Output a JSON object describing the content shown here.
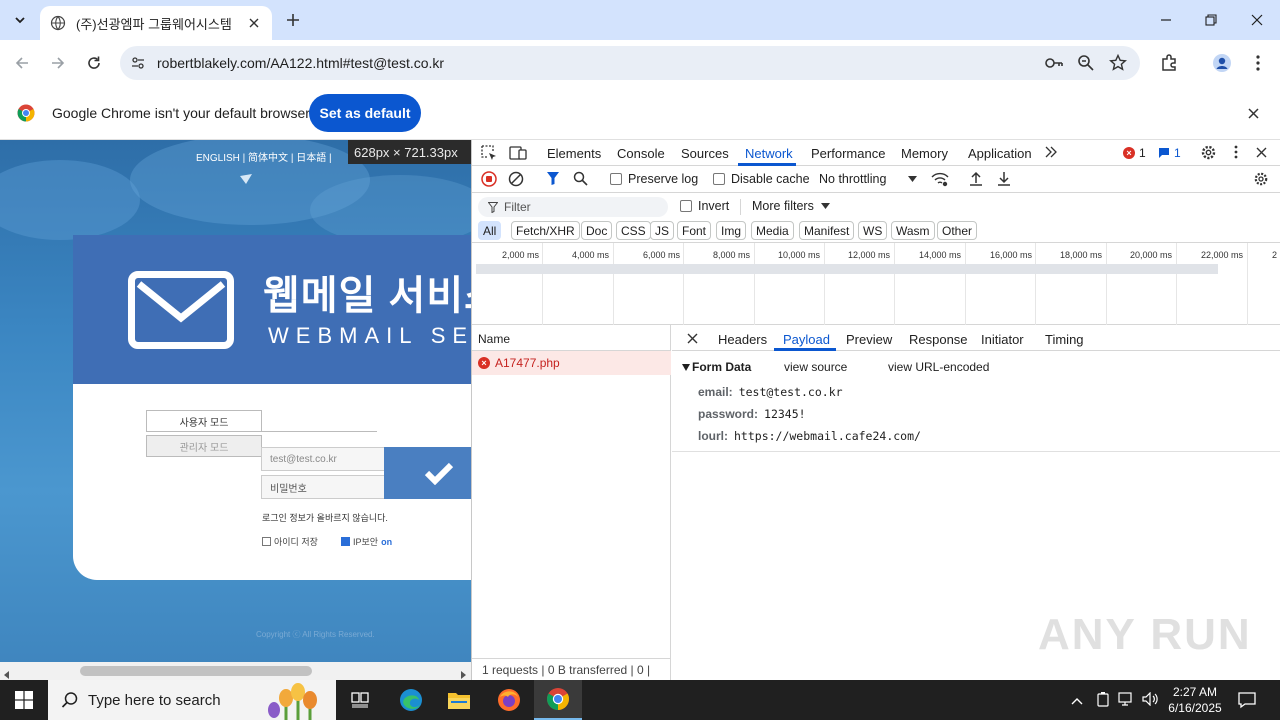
{
  "browser": {
    "tab_title": "(주)선광엠파 그룹웨어시스템",
    "url": "robertblakely.com/AA122.html#test@test.co.kr"
  },
  "infobar": {
    "message": "Google Chrome isn't your default browser",
    "button": "Set as default"
  },
  "webpage": {
    "lang_links": "ENGLISH  |  简体中文  |  日本語  |",
    "size_tooltip": "628px × 721.33px",
    "title": "웹메일 서비스",
    "subtitle": "WEBMAIL SERVICE",
    "user_mode_tab": "사용자 모드",
    "admin_mode_tab": "관리자 모드",
    "email_value": "test@test.co.kr",
    "password_placeholder": "비밀번호",
    "error_message": "로그인 정보가 올바르지 않습니다.",
    "save_id_label": "아이디 저장",
    "ip_security_label": "IP보안",
    "ip_security_state": "on",
    "copyright": "Copyright ⓒ All Rights Reserved."
  },
  "devtools": {
    "tabs": [
      "Elements",
      "Console",
      "Sources",
      "Network",
      "Performance",
      "Memory",
      "Application"
    ],
    "active_tab": "Network",
    "error_count": "1",
    "message_count": "1",
    "toolbar": {
      "preserve_log": "Preserve log",
      "disable_cache": "Disable cache",
      "throttling": "No throttling"
    },
    "filter": {
      "placeholder": "Filter",
      "invert": "Invert",
      "more_filters": "More filters"
    },
    "type_filters": [
      "All",
      "Fetch/XHR",
      "Doc",
      "CSS",
      "JS",
      "Font",
      "Img",
      "Media",
      "Manifest",
      "WS",
      "Wasm",
      "Other"
    ],
    "timeline_ticks": [
      "2,000 ms",
      "4,000 ms",
      "6,000 ms",
      "8,000 ms",
      "10,000 ms",
      "12,000 ms",
      "14,000 ms",
      "16,000 ms",
      "18,000 ms",
      "20,000 ms",
      "22,000 ms",
      "2"
    ],
    "requests": {
      "column_name": "Name",
      "items": [
        {
          "name": "A17477.php",
          "status": "error"
        }
      ],
      "status_bar": "1 requests   |   0 B transferred   |   0 |"
    },
    "detail_tabs": [
      "Headers",
      "Payload",
      "Preview",
      "Response",
      "Initiator",
      "Timing"
    ],
    "active_detail_tab": "Payload",
    "payload": {
      "section": "Form Data",
      "view_source": "view source",
      "view_url_encoded": "view URL-encoded",
      "fields": [
        {
          "key": "email:",
          "value": "test@test.co.kr"
        },
        {
          "key": "password:",
          "value": "12345!"
        },
        {
          "key": "lourl:",
          "value": "https://webmail.cafe24.com/"
        }
      ]
    },
    "watermark": "ANY RUN"
  },
  "taskbar": {
    "search_placeholder": "Type here to search",
    "time": "2:27 AM",
    "date": "6/16/2025"
  },
  "colors": {
    "chrome_accent": "#0b57d0",
    "page_header_blue": "#3f6eb5",
    "error_red": "#d93025"
  }
}
